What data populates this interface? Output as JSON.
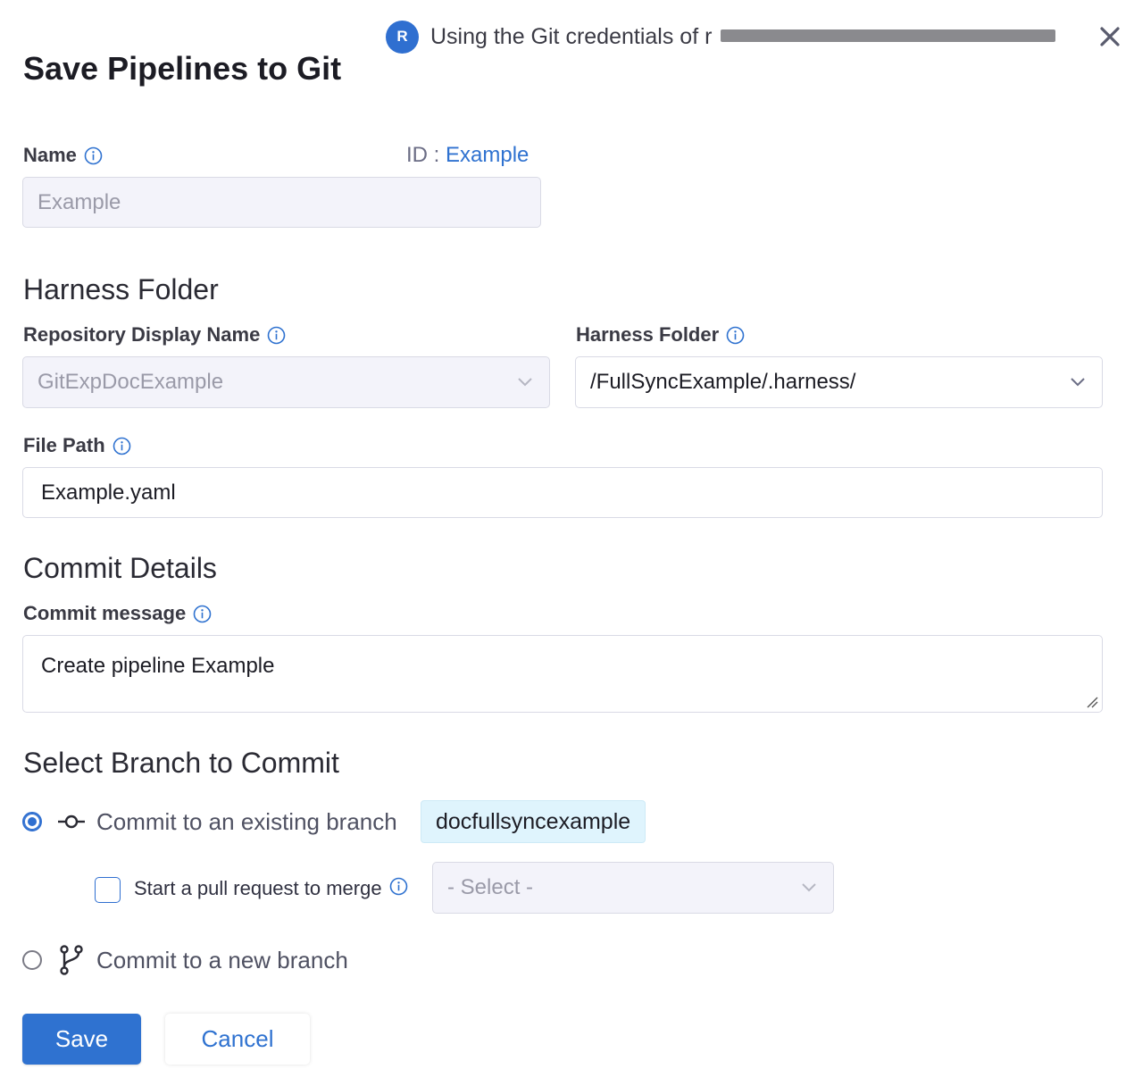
{
  "header": {
    "avatar_initial": "R",
    "credentials_text": "Using the Git credentials of r"
  },
  "dialog": {
    "title": "Save Pipelines to Git"
  },
  "name_field": {
    "label": "Name",
    "id_label": "ID :",
    "id_value": "Example",
    "value": "Example"
  },
  "harness_folder_section": {
    "title": "Harness Folder",
    "repo_label": "Repository Display Name",
    "repo_value": "GitExpDocExample",
    "folder_label": "Harness Folder",
    "folder_value": "/FullSyncExample/.harness/",
    "file_path_label": "File Path",
    "file_path_value": "Example.yaml"
  },
  "commit_section": {
    "title": "Commit Details",
    "message_label": "Commit message",
    "message_value": "Create pipeline Example"
  },
  "branch_section": {
    "title": "Select Branch to Commit",
    "existing_option": "Commit to an existing branch",
    "existing_branch": "docfullsyncexample",
    "pr_label": "Start a pull request to merge",
    "pr_select_placeholder": "- Select -",
    "new_option": "Commit to a new branch"
  },
  "actions": {
    "save": "Save",
    "cancel": "Cancel"
  },
  "colors": {
    "accent": "#2f72d0",
    "chip_bg": "#dff4fd",
    "disabled_bg": "#f3f3fa"
  }
}
